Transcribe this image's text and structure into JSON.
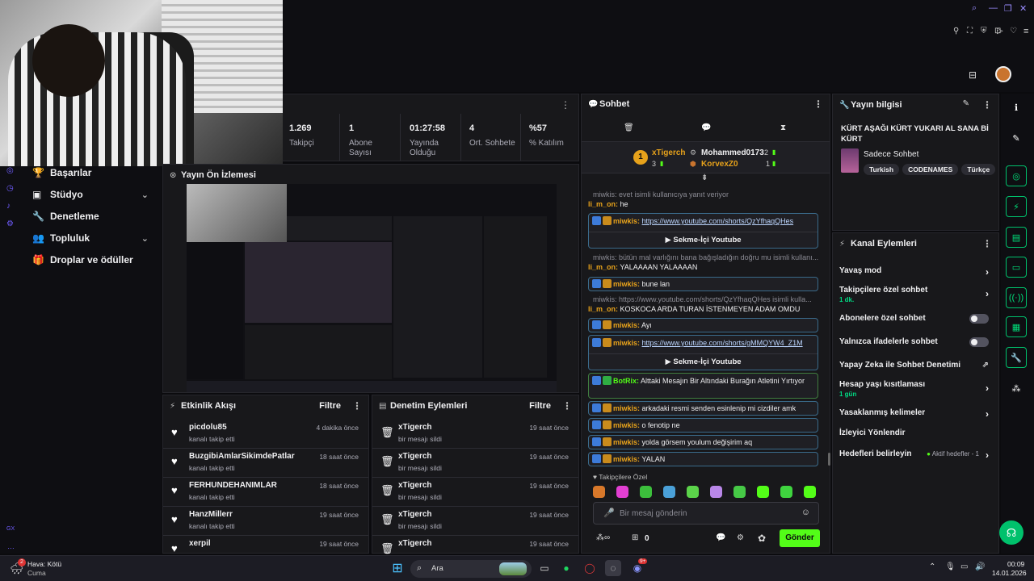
{
  "stats": [
    {
      "value": "1.269",
      "label": "Takipçi"
    },
    {
      "value": "1",
      "label": "Abone Sayısı"
    },
    {
      "value": "01:27:58",
      "label": "Yayında Olduğu"
    },
    {
      "value": "4",
      "label": "Ort. Sohbete"
    },
    {
      "value": "%57",
      "label": "% Katılım"
    }
  ],
  "nav": {
    "items": [
      {
        "label": "Başarılar"
      },
      {
        "label": "Stüdyo"
      },
      {
        "label": "Denetleme"
      },
      {
        "label": "Topluluk"
      },
      {
        "label": "Droplar ve ödüller"
      }
    ]
  },
  "preview": {
    "title": "Yayın Ön İzlemesi"
  },
  "activity": {
    "title": "Etkinlik Akışı",
    "filter": "Filtre",
    "rows": [
      {
        "name": "picdolu85",
        "action": "kanalı takip etti",
        "time": "4 dakika önce"
      },
      {
        "name": "BuzgibiAmlarSikimdePatlar",
        "action": "kanalı takip etti",
        "time": "18 saat önce"
      },
      {
        "name": "FERHUNDEHANIMLAR",
        "action": "kanalı takip etti",
        "time": "18 saat önce"
      },
      {
        "name": "HanzMillerr",
        "action": "kanalı takip etti",
        "time": "19 saat önce"
      },
      {
        "name": "xerpil",
        "action": "",
        "time": "19 saat önce"
      }
    ]
  },
  "moderation": {
    "title": "Denetim Eylemleri",
    "filter": "Filtre",
    "rows": [
      {
        "name": "xTigerch",
        "action": "bir mesajı sildi",
        "time": "19 saat önce"
      },
      {
        "name": "xTigerch",
        "action": "bir mesajı sildi",
        "time": "19 saat önce"
      },
      {
        "name": "xTigerch",
        "action": "bir mesajı sildi",
        "time": "19 saat önce"
      },
      {
        "name": "xTigerch",
        "action": "bir mesajı sildi",
        "time": "19 saat önce"
      },
      {
        "name": "xTigerch",
        "action": "",
        "time": "19 saat önce"
      }
    ]
  },
  "chat": {
    "title": "Sohbet",
    "leaderboard": {
      "first": "xTigerch",
      "first_rank": "1",
      "first_count": "3",
      "second": "Mohammed0173",
      "second_count": "2",
      "third": "KorvexZ0",
      "third_count": "1"
    },
    "lines": [
      {
        "reply": "miwkis: evet isimli kullanıcıya yanıt veriyor",
        "user": "li_m_on:",
        "text": "he"
      },
      {
        "user": "miwkis:",
        "link": "https://www.youtube.com/shorts/QzYfhaqQHes",
        "button": "Sekme-İçi Youtube"
      },
      {
        "reply": "miwkis: bütün mal varlığını bana bağışladığın doğru mu isimli kullanı...",
        "user": "li_m_on:",
        "text": "YALAAAAN YALAAAAN"
      },
      {
        "user": "miwkis:",
        "text": "bune lan"
      },
      {
        "reply": "miwkis: https://www.youtube.com/shorts/QzYfhaqQHes isimli kulla...",
        "user": "li_m_on:",
        "text": "KOSKOCA ARDA TURAN İSTENMEYEN ADAM OMDU"
      },
      {
        "user": "miwkis:",
        "text": "Ayı"
      },
      {
        "user": "miwkis:",
        "link": "https://www.youtube.com/shorts/gMMQYW4_Z1M",
        "button": "Sekme-İçi Youtube"
      },
      {
        "user": "BotRix:",
        "text": "Alttaki Mesajın Bir Altındaki Burağın Atletini Yırtıyor"
      },
      {
        "user": "miwkis:",
        "text": "arkadaki resmi senden esinlenip mi cizdiler amk"
      },
      {
        "user": "miwkis:",
        "text": "o fenotip ne"
      },
      {
        "user": "miwkis:",
        "text": "yolda görsem youlum değişirim aq"
      },
      {
        "user": "miwkis:",
        "text": "YALAN"
      }
    ],
    "followers_only": "Takipçilere Özel",
    "input_placeholder": "Bir mesaj gönderin",
    "points": "0",
    "send": "Gönder"
  },
  "stream_info": {
    "header": "Yayın bilgisi",
    "title": "KÜRT AŞAĞI KÜRT YUKARI AL SANA Bİ KÜRT",
    "category": "Sadece Sohbet",
    "tags": [
      "Turkish",
      "CODENAMES",
      "Türkçe"
    ]
  },
  "channel_actions": {
    "header": "Kanal Eylemleri",
    "items": [
      {
        "label": "Yavaş mod",
        "type": "chevron"
      },
      {
        "label": "Takipçilere özel sohbet",
        "sub": "1 dk.",
        "type": "chevron"
      },
      {
        "label": "Abonelere özel sohbet",
        "type": "toggle"
      },
      {
        "label": "Yalnızca ifadelerle sohbet",
        "type": "toggle"
      },
      {
        "label": "Yapay Zeka ile Sohbet Denetimi",
        "type": "external"
      },
      {
        "label": "Hesap yaşı kısıtlaması",
        "sub": "1 gün",
        "type": "chevron"
      },
      {
        "label": "Yasaklanmış kelimeler",
        "type": "chevron"
      },
      {
        "label": "İzleyici Yönlendir",
        "type": "none"
      },
      {
        "label": "Hedefleri belirleyin",
        "extra": "Aktif hedefler - 1",
        "type": "chevron"
      }
    ]
  },
  "taskbar": {
    "weather_title": "Hava: Kötü",
    "weather_sub": "Cuma",
    "weather_badge": "2",
    "search": "Ara",
    "time": "00:09",
    "date": "14.01.2026",
    "discord_badge": "9+"
  },
  "sidebar_small": "GX",
  "colors": {
    "accent": "#53fc18",
    "panel": "#18181b",
    "bg": "#0b0b0e"
  }
}
